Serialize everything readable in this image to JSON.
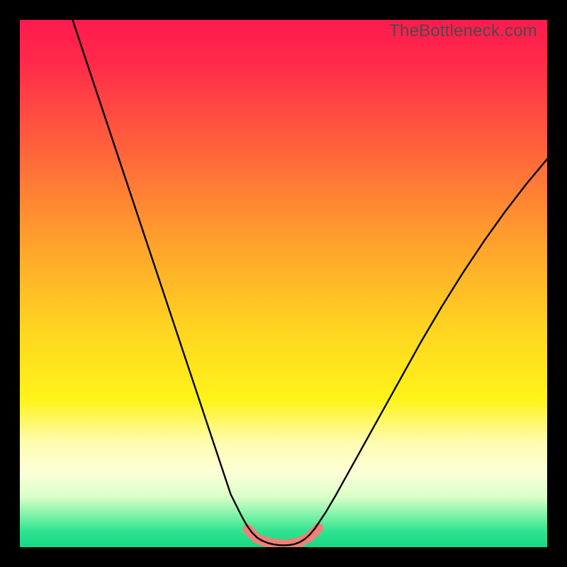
{
  "watermark": "TheBottleneck.com",
  "chart_data": {
    "type": "line",
    "title": "",
    "xlabel": "",
    "ylabel": "",
    "xlim": [
      0,
      100
    ],
    "ylim": [
      0,
      100
    ],
    "grid": false,
    "legend": false,
    "background_gradient": {
      "stops": [
        {
          "pos": 0.0,
          "color": "#ff1a4e"
        },
        {
          "pos": 0.08,
          "color": "#ff2a4a"
        },
        {
          "pos": 0.22,
          "color": "#ff5a3e"
        },
        {
          "pos": 0.4,
          "color": "#ff9a2e"
        },
        {
          "pos": 0.58,
          "color": "#ffd321"
        },
        {
          "pos": 0.72,
          "color": "#fff31a"
        },
        {
          "pos": 0.8,
          "color": "#fffcb0"
        },
        {
          "pos": 0.86,
          "color": "#fdffd8"
        },
        {
          "pos": 0.905,
          "color": "#d9ffc8"
        },
        {
          "pos": 0.94,
          "color": "#7df2a8"
        },
        {
          "pos": 0.97,
          "color": "#2fe38f"
        },
        {
          "pos": 1.0,
          "color": "#17d885"
        }
      ]
    },
    "series": [
      {
        "name": "bottleneck-curve",
        "color": "#000000",
        "width": 2.4,
        "x": [
          10,
          12,
          14,
          16,
          18,
          20,
          22,
          24,
          26,
          28,
          30,
          32,
          34,
          36,
          38,
          40,
          41,
          42,
          43,
          44,
          45,
          46,
          47,
          48,
          49,
          50,
          51,
          52,
          53,
          54,
          55,
          56,
          58,
          60,
          62,
          65,
          68,
          72,
          76,
          80,
          84,
          88,
          92,
          96,
          100
        ],
        "y": [
          100,
          94,
          88,
          82,
          76,
          70,
          64,
          58,
          52,
          46,
          40,
          34,
          28,
          22,
          16,
          10,
          8,
          6,
          4.2,
          2.8,
          1.8,
          1.2,
          0.8,
          0.55,
          0.4,
          0.35,
          0.4,
          0.55,
          0.9,
          1.5,
          2.4,
          3.6,
          6.6,
          10,
          13.6,
          19,
          24.4,
          31.6,
          38.8,
          45.6,
          52,
          58,
          63.6,
          68.8,
          73.6
        ]
      },
      {
        "name": "minimum-marker",
        "type": "marker-track",
        "color": "#f08078",
        "width": 14,
        "cap": "round",
        "points_x": [
          43.2,
          45.0,
          47.0,
          49.0,
          51.0,
          53.0,
          55.0,
          56.6
        ],
        "points_y": [
          3.4,
          1.6,
          0.9,
          0.5,
          0.5,
          0.9,
          2.0,
          3.6
        ]
      }
    ]
  }
}
